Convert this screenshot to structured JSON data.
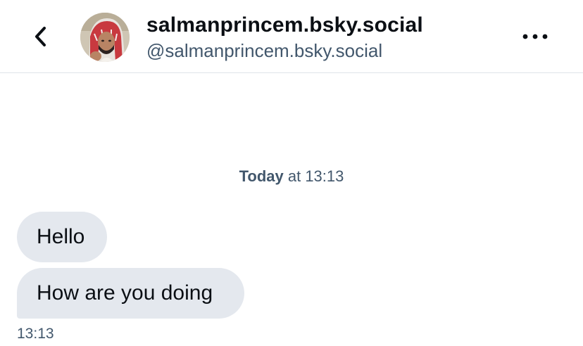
{
  "header": {
    "back_icon": "chevron-left-icon",
    "avatar_icon": "profile-photo",
    "display_name": "salmanprincem.bsky.social",
    "handle": "@salmanprincem.bsky.social",
    "more_icon": "ellipsis-horizontal-icon"
  },
  "conversation": {
    "date_separator": {
      "day": "Today",
      "rest": " at 13:13"
    },
    "messages": [
      {
        "text": "Hello"
      },
      {
        "text": "How are you doing"
      }
    ],
    "last_message_time": "13:13"
  },
  "colors": {
    "bubble_background": "#e4e8ee",
    "muted_text": "#42576c",
    "primary_text": "#0b0f14",
    "divider": "#dfe3e8"
  }
}
